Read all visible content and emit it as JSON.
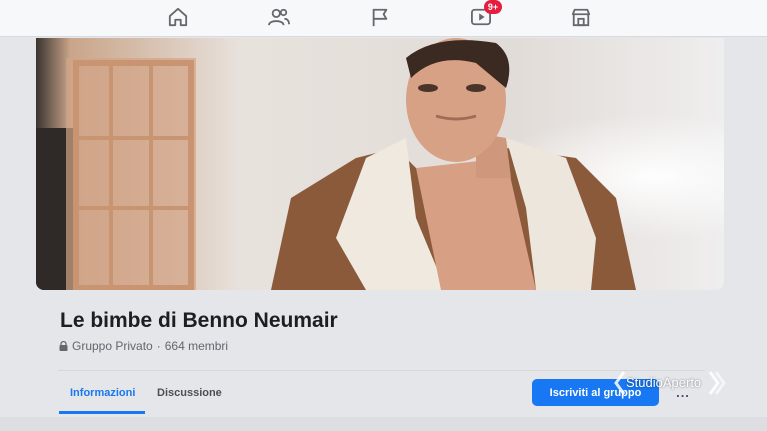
{
  "nav": {
    "icons": [
      "home-icon",
      "friends-icon",
      "pages-flag-icon",
      "watch-video-icon",
      "marketplace-store-icon"
    ],
    "watch_badge": "9+"
  },
  "group": {
    "title": "Le bimbe di Benno Neumair",
    "privacy": "Gruppo Privato",
    "separator": "·",
    "members": "664 membri"
  },
  "tabs": {
    "informazioni": "Informazioni",
    "discussione": "Discussione"
  },
  "actions": {
    "join_label": "Iscriviti al gruppo",
    "more_label": "..."
  },
  "watermark": {
    "text": "StudioAperto"
  },
  "colors": {
    "accent": "#1877f2",
    "badge": "#e41e3f"
  }
}
